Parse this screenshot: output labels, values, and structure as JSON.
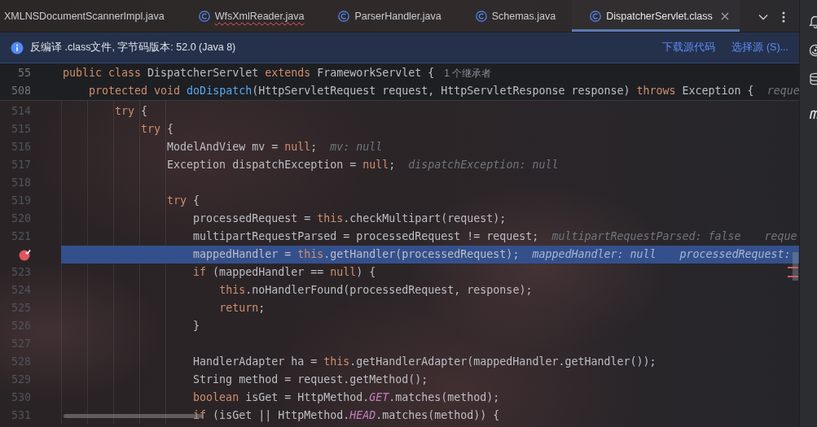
{
  "tabs": [
    {
      "label": "XMLNSDocumentScannerImpl.java",
      "icon": false,
      "error": false,
      "selected": false
    },
    {
      "label": "WfsXmlReader.java",
      "icon": true,
      "error": true,
      "selected": false
    },
    {
      "label": "ParserHandler.java",
      "icon": true,
      "error": false,
      "selected": false
    },
    {
      "label": "Schemas.java",
      "icon": true,
      "error": false,
      "selected": false
    },
    {
      "label": "DispatcherServlet.class",
      "icon": true,
      "error": false,
      "selected": true
    }
  ],
  "right_toolbar": [
    {
      "kind": "bell"
    },
    {
      "kind": "spiral"
    },
    {
      "kind": "database"
    },
    {
      "kind": "letter"
    }
  ],
  "info_bar": {
    "message": "反编译 .class文件, 字节码版本: 52.0 (Java 8)",
    "links": [
      "下载源代码",
      "选择源 (S)..."
    ]
  },
  "sticky_lines": [
    {
      "number": "55",
      "code": [
        {
          "kind": "keyword",
          "text": "public class"
        },
        {
          "kind": "plain",
          "text": " DispatcherServlet "
        },
        {
          "kind": "keyword",
          "text": "extends"
        },
        {
          "kind": "plain",
          "text": " FrameworkServlet {"
        }
      ],
      "hints": [
        {
          "kind": "inheritors",
          "text": "1 个继承者"
        }
      ]
    },
    {
      "number": "508",
      "code": [
        {
          "kind": "keyword",
          "text": "    protected void "
        },
        {
          "kind": "method",
          "text": "doDispatch"
        },
        {
          "kind": "plain",
          "text": "(HttpServletRequest request, HttpServletResponse response) "
        },
        {
          "kind": "keyword",
          "text": "throws"
        },
        {
          "kind": "plain",
          "text": " Exception {"
        }
      ],
      "hints": [
        {
          "kind": "value",
          "text": "reque"
        }
      ]
    }
  ],
  "lines": [
    {
      "number": "514",
      "breakpoint": false,
      "current": false,
      "code": [
        {
          "kind": "keyword",
          "text": "        try"
        },
        {
          "kind": "plain",
          "text": " {"
        }
      ]
    },
    {
      "number": "515",
      "breakpoint": false,
      "current": false,
      "code": [
        {
          "kind": "keyword",
          "text": "            try"
        },
        {
          "kind": "plain",
          "text": " {"
        }
      ]
    },
    {
      "number": "516",
      "breakpoint": false,
      "current": false,
      "code": [
        {
          "kind": "plain",
          "text": "                ModelAndView mv = "
        },
        {
          "kind": "keyword",
          "text": "null"
        },
        {
          "kind": "plain",
          "text": ";"
        }
      ],
      "hints": [
        {
          "kind": "value",
          "text": "mv: null"
        }
      ]
    },
    {
      "number": "517",
      "breakpoint": false,
      "current": false,
      "code": [
        {
          "kind": "plain",
          "text": "                Exception dispatchException = "
        },
        {
          "kind": "keyword",
          "text": "null"
        },
        {
          "kind": "plain",
          "text": ";"
        }
      ],
      "hints": [
        {
          "kind": "value",
          "text": "dispatchException: null"
        }
      ]
    },
    {
      "number": "518",
      "breakpoint": false,
      "current": false
    },
    {
      "number": "519",
      "breakpoint": false,
      "current": false,
      "code": [
        {
          "kind": "keyword",
          "text": "                try"
        },
        {
          "kind": "plain",
          "text": " {"
        }
      ]
    },
    {
      "number": "520",
      "breakpoint": false,
      "current": false,
      "code": [
        {
          "kind": "plain",
          "text": "                    processedRequest = "
        },
        {
          "kind": "keyword",
          "text": "this"
        },
        {
          "kind": "plain",
          "text": ".checkMultipart(request);"
        }
      ]
    },
    {
      "number": "521",
      "breakpoint": false,
      "current": false,
      "code": [
        {
          "kind": "plain",
          "text": "                    multipartRequestParsed = processedRequest != request;"
        }
      ],
      "hints": [
        {
          "kind": "value",
          "text": "multipartRequestParsed: false"
        },
        {
          "kind": "value",
          "text": "reque"
        }
      ]
    },
    {
      "breakpoint": true,
      "current": true,
      "code": [
        {
          "kind": "plain",
          "text": "                    mappedHandler = "
        },
        {
          "kind": "keyword",
          "text": "this"
        },
        {
          "kind": "plain",
          "text": ".getHandler(processedRequest);"
        }
      ],
      "hints": [
        {
          "kind": "value",
          "text": "mappedHandler: null"
        },
        {
          "kind": "value",
          "text": "processedRequest:"
        }
      ]
    },
    {
      "number": "523",
      "breakpoint": false,
      "current": false,
      "code": [
        {
          "kind": "keyword",
          "text": "                    if"
        },
        {
          "kind": "plain",
          "text": " (mappedHandler == "
        },
        {
          "kind": "keyword",
          "text": "null"
        },
        {
          "kind": "plain",
          "text": ") {"
        }
      ]
    },
    {
      "number": "524",
      "breakpoint": false,
      "current": false,
      "code": [
        {
          "kind": "keyword",
          "text": "                        this"
        },
        {
          "kind": "plain",
          "text": ".noHandlerFound(processedRequest, response);"
        }
      ]
    },
    {
      "number": "525",
      "breakpoint": false,
      "current": false,
      "code": [
        {
          "kind": "keyword",
          "text": "                        return"
        },
        {
          "kind": "plain",
          "text": ";"
        }
      ]
    },
    {
      "number": "526",
      "breakpoint": false,
      "current": false,
      "code": [
        {
          "kind": "plain",
          "text": "                    }"
        }
      ]
    },
    {
      "number": "527",
      "breakpoint": false,
      "current": false
    },
    {
      "number": "528",
      "breakpoint": false,
      "current": false,
      "code": [
        {
          "kind": "plain",
          "text": "                    HandlerAdapter ha = "
        },
        {
          "kind": "keyword",
          "text": "this"
        },
        {
          "kind": "plain",
          "text": ".getHandlerAdapter(mappedHandler.getHandler());"
        }
      ]
    },
    {
      "number": "529",
      "breakpoint": false,
      "current": false,
      "code": [
        {
          "kind": "plain",
          "text": "                    String method = request.getMethod();"
        }
      ]
    },
    {
      "number": "530",
      "breakpoint": false,
      "current": false,
      "code": [
        {
          "kind": "keyword",
          "text": "                    boolean"
        },
        {
          "kind": "plain",
          "text": " isGet = HttpMethod."
        },
        {
          "kind": "static_field",
          "text": "GET"
        },
        {
          "kind": "plain",
          "text": ".matches(method);"
        }
      ]
    },
    {
      "number": "531",
      "breakpoint": false,
      "current": false,
      "code": [
        {
          "kind": "keyword",
          "text": "                    if"
        },
        {
          "kind": "plain",
          "text": " (isGet || HttpMethod."
        },
        {
          "kind": "static_field",
          "text": "HEAD"
        },
        {
          "kind": "plain",
          "text": ".matches(method)) {"
        }
      ]
    }
  ]
}
